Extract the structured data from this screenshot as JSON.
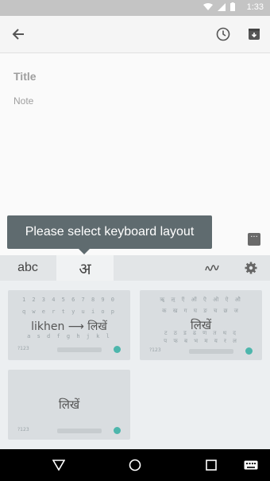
{
  "status_bar": {
    "time": "1:33"
  },
  "note": {
    "title_placeholder": "Title",
    "body_placeholder": "Note"
  },
  "tooltip": {
    "text": "Please select keyboard layout"
  },
  "keyboard": {
    "tabs": [
      {
        "label": "abc"
      },
      {
        "label": "अ"
      }
    ],
    "layouts": [
      {
        "label": "likhen ⟶ लिखें",
        "row1": "1 2 3 4 5 6 7 8 9 0",
        "row2": "q w e r t y u i o p",
        "row3": "a s d f g h j k l",
        "row4": "z x c v b n m",
        "sym": "?123"
      },
      {
        "label": "लिखें",
        "row1": "ॠ ऌ ऍ ऑ ऎ ऒ ऐ औ",
        "row2": "क ख ग घ ङ च छ ज",
        "row3": "ट ठ ड ढ ण त थ द",
        "row4": "प फ ब भ म य र ल",
        "sym": "?123"
      },
      {
        "label": "लिखें",
        "sym": "?123"
      }
    ]
  },
  "colors": {
    "status_bar": "#c4c4c4",
    "tooltip": "#5f6b6f",
    "accent": "#4db6ac"
  }
}
